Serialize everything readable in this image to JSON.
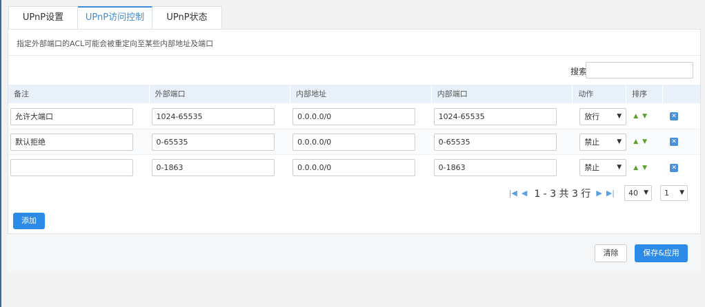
{
  "tabs": [
    {
      "label": "UPnP设置"
    },
    {
      "label": "UPnP访问控制"
    },
    {
      "label": "UPnP状态"
    }
  ],
  "hint": "指定外部端口的ACL可能会被重定向至某些内部地址及端口",
  "search": {
    "label": "搜索:",
    "value": ""
  },
  "columns": [
    "备注",
    "外部端口",
    "内部地址",
    "内部端口",
    "动作",
    "排序",
    ""
  ],
  "rows": [
    {
      "remark": "允许大端口",
      "ext_port": "1024-65535",
      "int_addr": "0.0.0.0/0",
      "int_port": "1024-65535",
      "action": "放行"
    },
    {
      "remark": "默认拒绝",
      "ext_port": "0-65535",
      "int_addr": "0.0.0.0/0",
      "int_port": "0-65535",
      "action": "禁止"
    },
    {
      "remark": "",
      "ext_port": "0-1863",
      "int_addr": "0.0.0.0/0",
      "int_port": "0-1863",
      "action": "禁止"
    }
  ],
  "pager": {
    "summary": "1 - 3 共 3 行",
    "page_size": "40",
    "page": "1"
  },
  "buttons": {
    "add": "添加",
    "clear": "清除",
    "save": "保存&应用"
  },
  "icons": {
    "first": "first-page-icon",
    "prev": "prev-page-icon",
    "next": "next-page-icon",
    "last": "last-page-icon"
  },
  "colors": {
    "accent": "#2d8be8",
    "header_bg": "#e8f1f9",
    "move_arrow": "#5aa02c"
  }
}
